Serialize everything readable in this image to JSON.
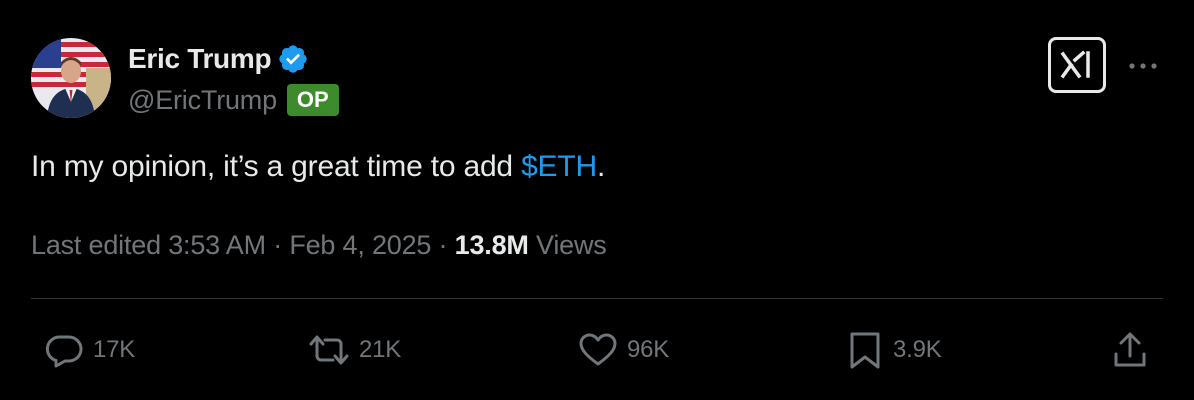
{
  "author": {
    "display_name": "Eric Trump",
    "handle": "@EricTrump",
    "badge": "OP",
    "verified": true,
    "verified_color": "#1d9bf0"
  },
  "post": {
    "text_before": "In my opinion, it’s a great time to add ",
    "cashtag": "$ETH",
    "text_after": ".",
    "edited_label": "Last edited",
    "time": "3:53 AM",
    "separator": "·",
    "date": "Feb 4, 2025",
    "views_count": "13.8M",
    "views_label": "Views"
  },
  "actions": {
    "replies": "17K",
    "reposts": "21K",
    "likes": "96K",
    "bookmarks": "3.9K"
  },
  "icons": {
    "logo": "xai-logo-icon",
    "more": "more-dots-icon",
    "reply": "reply-bubble-icon",
    "repost": "repost-arrows-icon",
    "like": "heart-icon",
    "bookmark": "bookmark-icon",
    "share": "share-upload-icon"
  },
  "colors": {
    "background": "#000000",
    "text_primary": "#e7e9ea",
    "text_secondary": "#71767b",
    "link": "#1d9bf0",
    "badge_bg": "#3d8b2c",
    "divider": "#2f3336"
  }
}
